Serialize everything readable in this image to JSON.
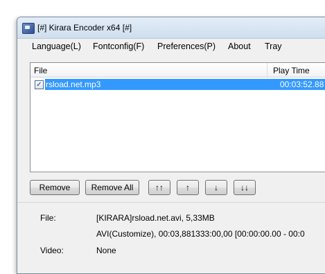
{
  "window": {
    "title": "[#] Kirara Encoder x64 [#]"
  },
  "menu": [
    "Language(L)",
    "Fontconfig(F)",
    "Preferences(P)",
    "About",
    "Tray"
  ],
  "file_list": {
    "columns": {
      "file": "File",
      "play_time": "Play Time"
    },
    "rows": [
      {
        "checked": true,
        "check_mark": "✓",
        "file": "rsload.net.mp3",
        "play_time": "00:03:52.88"
      }
    ]
  },
  "buttons": {
    "remove": "Remove",
    "remove_all": "Remove All",
    "move_top": "↑↑",
    "move_up": "↑",
    "move_down": "↓",
    "move_bottom": "↓↓"
  },
  "info": {
    "file_label": "File:",
    "file_value": "[KIRARA]rsload.net.avi, 5,33MB",
    "file_detail": "AVI(Customize), 00:03,881333:00,00 [00:00:00.00 - 00:0",
    "video_label": "Video:",
    "video_value": "None"
  },
  "colors": {
    "selection": "#3399ff",
    "window_bg": "#f0f0f0"
  }
}
